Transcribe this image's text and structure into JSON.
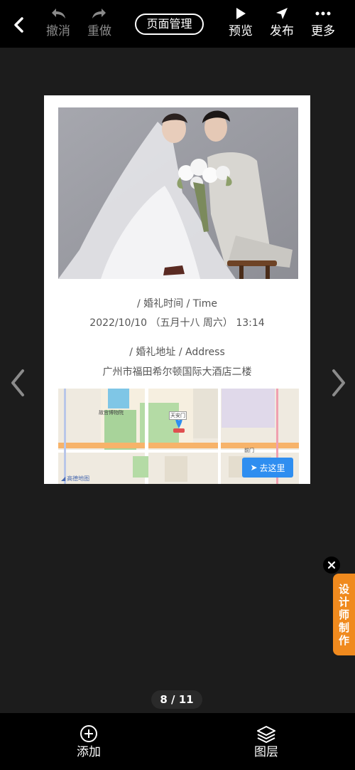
{
  "toolbar": {
    "undo_label": "撤消",
    "redo_label": "重做",
    "page_manage_label": "页面管理",
    "preview_label": "预览",
    "publish_label": "发布",
    "more_label": "更多"
  },
  "card": {
    "time_heading": "/ 婚礼时间 / Time",
    "time_value": "2022/10/10 （五月十八 周六） 13:14",
    "address_heading": "/ 婚礼地址 / Address",
    "address_value": "广州市福田希尔顿国际大酒店二楼",
    "map": {
      "go_button_label": "去这里",
      "place_label": "天安门",
      "brand_label": "高德地图",
      "poi_labels": [
        "故宫博物院",
        "天安门",
        "前门"
      ]
    }
  },
  "designer_tab": {
    "chars": [
      "设",
      "计",
      "师",
      "制",
      "作"
    ]
  },
  "pager": {
    "text": "8 / 11"
  },
  "bottom": {
    "add_label": "添加",
    "layer_label": "图层"
  },
  "colors": {
    "accent_orange": "#f08a1e",
    "map_button_blue": "#2f8ef0",
    "background": "#1c1c1c"
  }
}
